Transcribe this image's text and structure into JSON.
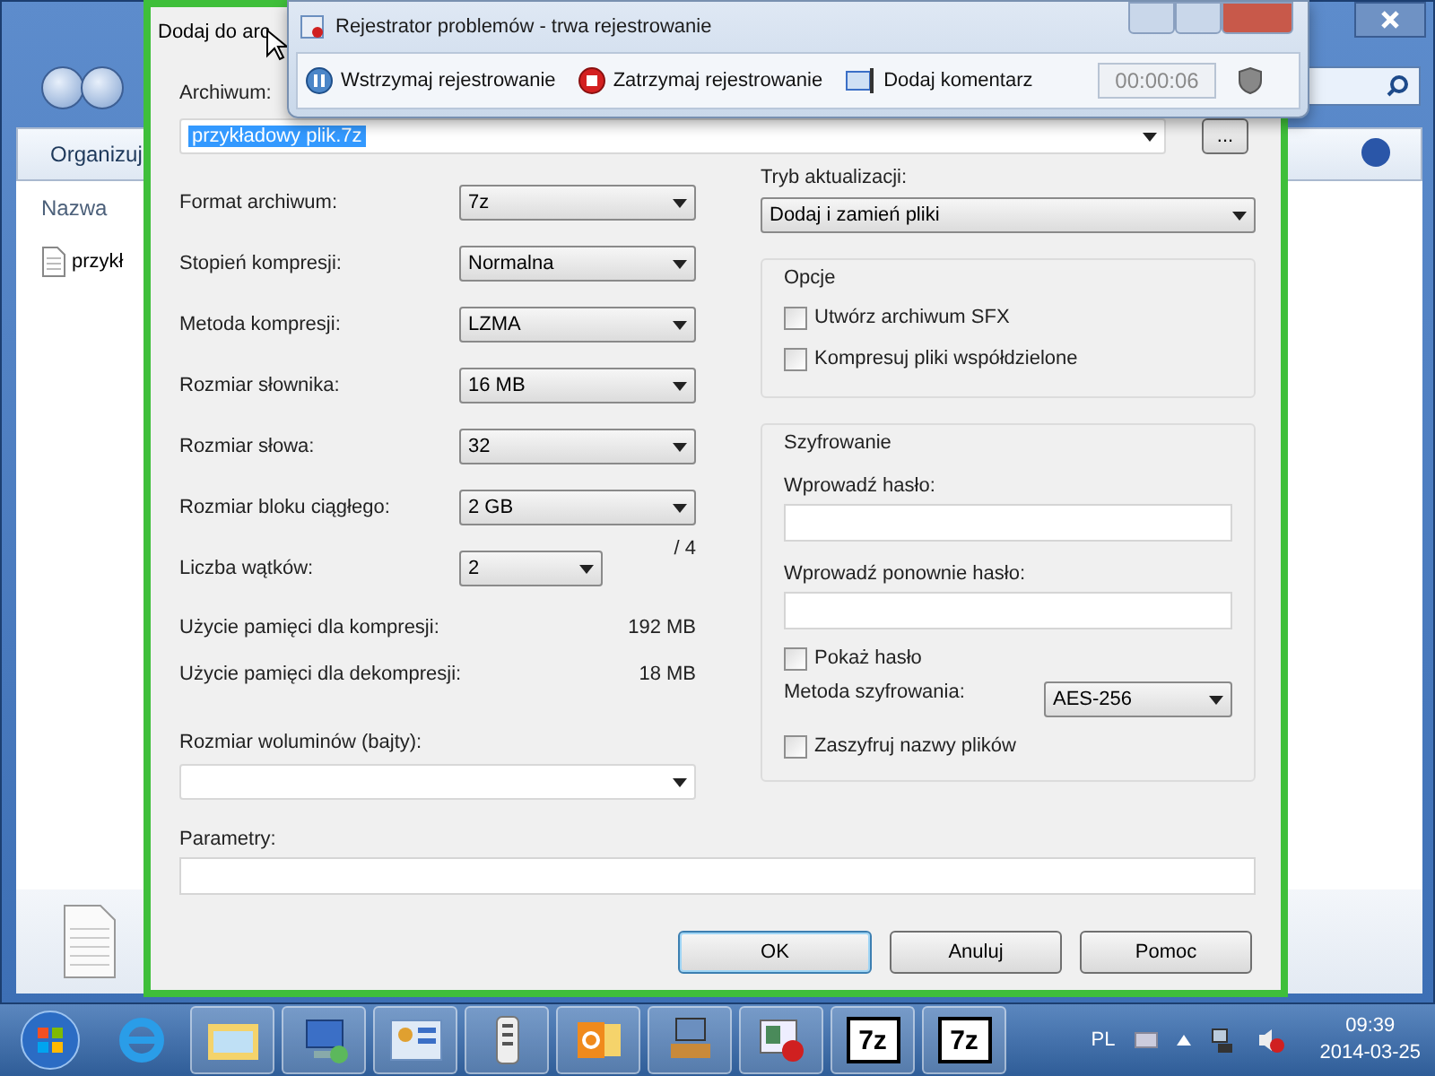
{
  "explorer": {
    "toolbar_button": "Organizuj",
    "column_header": "Nazwa",
    "file_name": "przykł"
  },
  "dialog": {
    "title": "Dodaj do arc",
    "archive_label": "Archiwum:",
    "archive_value": "przykładowy plik.7z",
    "browse_button": "...",
    "settings": [
      {
        "label": "Format archiwum:",
        "value": "7z"
      },
      {
        "label": "Stopień kompresji:",
        "value": "Normalna"
      },
      {
        "label": "Metoda kompresji:",
        "value": "LZMA"
      },
      {
        "label": "Rozmiar słownika:",
        "value": "16 MB"
      },
      {
        "label": "Rozmiar słowa:",
        "value": "32"
      },
      {
        "label": "Rozmiar bloku ciągłego:",
        "value": "2 GB"
      },
      {
        "label": "Liczba wątków:",
        "value": "2",
        "suffix": "/ 4"
      }
    ],
    "memory": [
      {
        "label": "Użycie pamięci dla kompresji:",
        "value": "192 MB"
      },
      {
        "label": "Użycie pamięci dla dekompresji:",
        "value": "18 MB"
      }
    ],
    "volume_label": "Rozmiar woluminów (bajty):",
    "update_mode": {
      "label": "Tryb aktualizacji:",
      "value": "Dodaj i zamień pliki"
    },
    "options": {
      "title": "Opcje",
      "checkboxes": [
        {
          "label": "Utwórz archiwum SFX",
          "checked": false
        },
        {
          "label": "Kompresuj pliki współdzielone",
          "checked": false
        }
      ]
    },
    "encryption": {
      "title": "Szyfrowanie",
      "password_label": "Wprowadź hasło:",
      "repeat_label": "Wprowadź ponownie hasło:",
      "show_password": {
        "label": "Pokaż hasło",
        "checked": false
      },
      "method_label": "Metoda szyfrowania:",
      "method_value": "AES-256",
      "encrypt_names": {
        "label": "Zaszyfruj nazwy plików",
        "checked": false
      }
    },
    "parameters_label": "Parametry:",
    "buttons": [
      {
        "label": "OK",
        "default": true
      },
      {
        "label": "Anuluj",
        "default": false
      },
      {
        "label": "Pomoc",
        "default": false
      }
    ]
  },
  "recorder": {
    "title": "Rejestrator problemów - trwa rejestrowanie",
    "actions": [
      {
        "kind": "pause",
        "label": "Wstrzymaj rejestrowanie"
      },
      {
        "kind": "stop",
        "label": "Zatrzymaj rejestrowanie"
      },
      {
        "kind": "comment",
        "label": "Dodaj komentarz"
      }
    ],
    "timer": "00:00:06"
  },
  "taskbar": {
    "apps": [
      {
        "kind": "ie"
      },
      {
        "kind": "folder"
      },
      {
        "kind": "network"
      },
      {
        "kind": "control"
      },
      {
        "kind": "remote"
      },
      {
        "kind": "outlook"
      },
      {
        "kind": "installer"
      },
      {
        "kind": "recorder"
      },
      {
        "kind": "archiver",
        "label": "7z"
      },
      {
        "kind": "archiver",
        "label": "7z"
      }
    ],
    "language": "PL",
    "time": "09:39",
    "date": "2014-03-25"
  }
}
